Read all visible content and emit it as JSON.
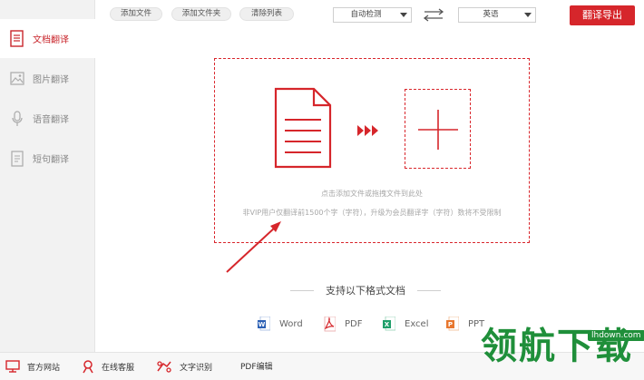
{
  "sidebar": {
    "items": [
      {
        "label": "文档翻译",
        "icon": "document-icon",
        "active": true
      },
      {
        "label": "图片翻译",
        "icon": "image-icon",
        "active": false
      },
      {
        "label": "语音翻译",
        "icon": "microphone-icon",
        "active": false
      },
      {
        "label": "短句翻译",
        "icon": "notepad-icon",
        "active": false
      }
    ]
  },
  "toolbar": {
    "add_file": "添加文件",
    "add_folder": "添加文件夹",
    "clear_list": "清除列表",
    "source_lang": "自动检测",
    "target_lang": "英语",
    "export": "翻译导出"
  },
  "dropzone": {
    "hint": "点击添加文件或拖拽文件到此处",
    "limit_note": "非VIP用户仅翻译前1500个字（字符），升级为会员翻译字（字符）数将不受限制"
  },
  "formats": {
    "title": "支持以下格式文档",
    "items": [
      {
        "label": "Word",
        "color": "#2b5fb4"
      },
      {
        "label": "PDF",
        "color": "#d6262b"
      },
      {
        "label": "Excel",
        "color": "#1f9f6a"
      },
      {
        "label": "PPT",
        "color": "#e8772e"
      }
    ]
  },
  "bottom": {
    "website": "官方网站",
    "support": "在线客服",
    "ocr": "文字识别",
    "pdf_edit": "PDF编辑"
  },
  "watermark": {
    "brand": "领航下载",
    "domain": "lhdown.com"
  },
  "colors": {
    "accent": "#d6262b",
    "sidebar_bg": "#f2f2f2"
  }
}
